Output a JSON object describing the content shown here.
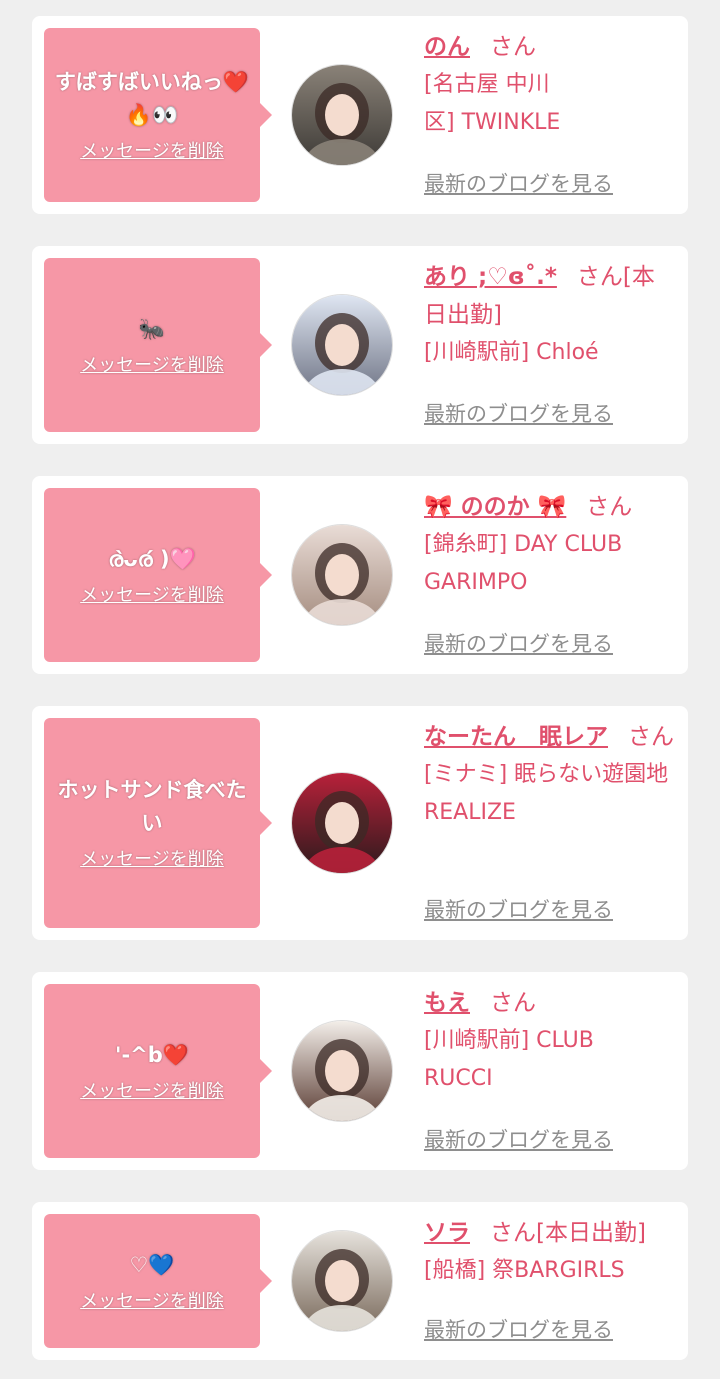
{
  "delete_label": "メッセージを削除",
  "blog_label": "最新のブログを見る",
  "colors": {
    "background": "#efefef",
    "card": "#ffffff",
    "bubble": "#f697a6",
    "accent": "#e0506c",
    "link_gray": "#8e8e8e"
  },
  "cards": [
    {
      "message": "すばすばいいねっ❤️🔥👀",
      "name": "のん",
      "suffix": "さん",
      "shop": "[名古屋 中川区] TWINKLE",
      "avatar_tone": [
        "#8a8278",
        "#3d3a36"
      ]
    },
    {
      "message": "🐜",
      "name": "あり ;♡ɞ˚.*",
      "suffix": "さん[本日出勤]",
      "shop": "[川崎駅前] Chloé",
      "avatar_tone": [
        "#dfe6f2",
        "#6f7485"
      ]
    },
    {
      "message": "ര̀ᴗര́ )🩷",
      "name": "🎀 ののか 🎀",
      "suffix": "さん",
      "shop": "[錦糸町] DAY CLUB GARIMPO",
      "avatar_tone": [
        "#e9dcd6",
        "#a58d80"
      ]
    },
    {
      "message": "ホットサンド食べたい",
      "name": "なーたん　眠レア",
      "suffix": "さん",
      "shop": "[ミナミ] 眠らない遊園地 REALIZE",
      "avatar_tone": [
        "#b8213a",
        "#2a1a1c"
      ]
    },
    {
      "message": "'-^b❤️",
      "name": "もえ",
      "suffix": "さん",
      "shop": "[川崎駅前] CLUB RUCCI",
      "avatar_tone": [
        "#f3eee9",
        "#5a3c33"
      ]
    },
    {
      "message": "♡💙",
      "name": "ソラ",
      "suffix": "さん[本日出勤]",
      "shop": "[船橋] 祭BARGIRLS",
      "avatar_tone": [
        "#e6e2dc",
        "#7a6a5c"
      ]
    }
  ]
}
